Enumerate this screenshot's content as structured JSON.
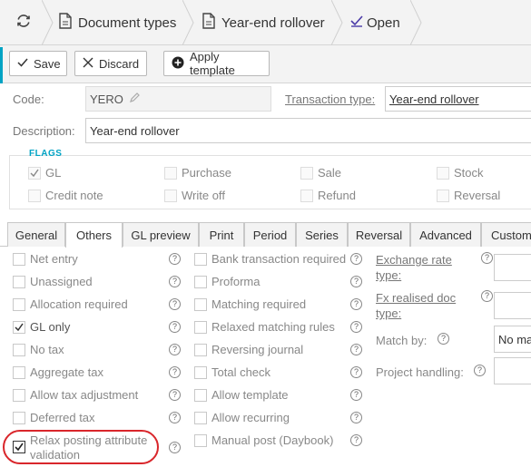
{
  "breadcrumb": {
    "refresh_icon": "refresh-icon",
    "items": [
      {
        "label": "Document types",
        "icon": "document-icon"
      },
      {
        "label": "Year-end rollover",
        "icon": "document-icon"
      },
      {
        "label": "Open",
        "icon": "checkmark-icon"
      }
    ]
  },
  "toolbar": {
    "save_label": "Save",
    "discard_label": "Discard",
    "apply_template_label": "Apply template"
  },
  "form": {
    "code_label": "Code:",
    "code_value": "YERO",
    "transaction_type_label": "Transaction type:",
    "transaction_type_value": "Year-end rollover",
    "description_label": "Description:",
    "description_value": "Year-end rollover"
  },
  "flags": {
    "title": "FLAGS",
    "items": [
      {
        "label": "GL",
        "checked": true
      },
      {
        "label": "Purchase",
        "checked": false
      },
      {
        "label": "Sale",
        "checked": false
      },
      {
        "label": "Stock",
        "checked": false
      },
      {
        "label": "Credit note",
        "checked": false
      },
      {
        "label": "Write off",
        "checked": false
      },
      {
        "label": "Refund",
        "checked": false
      },
      {
        "label": "Reversal",
        "checked": false
      }
    ]
  },
  "tabs": [
    {
      "label": "General",
      "active": false
    },
    {
      "label": "Others",
      "active": true
    },
    {
      "label": "GL preview",
      "active": false
    },
    {
      "label": "Print",
      "active": false
    },
    {
      "label": "Period",
      "active": false
    },
    {
      "label": "Series",
      "active": false
    },
    {
      "label": "Reversal",
      "active": false
    },
    {
      "label": "Advanced",
      "active": false
    },
    {
      "label": "Custom",
      "active": false
    }
  ],
  "others": {
    "col1": [
      {
        "label": "Net entry",
        "checked": false
      },
      {
        "label": "Unassigned",
        "checked": false
      },
      {
        "label": "Allocation required",
        "checked": false
      },
      {
        "label": "GL only",
        "checked": true
      },
      {
        "label": "No tax",
        "checked": false
      },
      {
        "label": "Aggregate tax",
        "checked": false
      },
      {
        "label": "Allow tax adjustment",
        "checked": false
      },
      {
        "label": "Deferred tax",
        "checked": false
      },
      {
        "label_line1": "Relax posting attribute",
        "label_line2": "validation",
        "checked": true
      }
    ],
    "col2": [
      {
        "label": "Bank transaction required",
        "checked": false
      },
      {
        "label": "Proforma",
        "checked": false
      },
      {
        "label": "Matching required",
        "checked": false
      },
      {
        "label": "Relaxed matching rules",
        "checked": false
      },
      {
        "label": "Reversing journal",
        "checked": false
      },
      {
        "label": "Total check",
        "checked": false
      },
      {
        "label": "Allow template",
        "checked": false
      },
      {
        "label": "Allow recurring",
        "checked": false
      },
      {
        "label": "Manual post (Daybook)",
        "checked": false
      }
    ],
    "col3": {
      "exchange_rate_type_line1": "Exchange rate",
      "exchange_rate_type_line2": "type:",
      "fx_realised_doc_type_line1": "Fx realised doc",
      "fx_realised_doc_type_line2": "type:",
      "match_by_label": "Match by:",
      "match_by_value": "No ma",
      "project_handling_label": "Project handling:"
    },
    "help_glyph": "?"
  },
  "colors": {
    "accent": "#00a3c4",
    "highlight": "#d9262b",
    "open_icon": "#4a3aa8"
  }
}
